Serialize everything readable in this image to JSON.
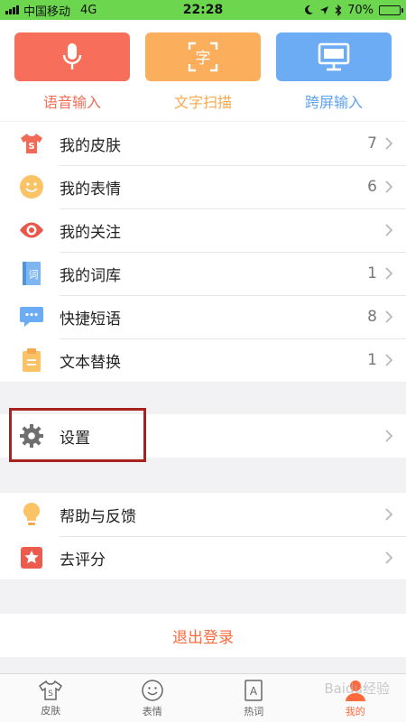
{
  "status_bar": {
    "carrier": "中国移动",
    "network": "4G",
    "time": "22:28",
    "battery_percent": "70%",
    "battery_level": 0.7,
    "icons": [
      "moon-icon",
      "location-icon",
      "bluetooth-icon"
    ]
  },
  "top_actions": [
    {
      "label": "语音输入",
      "icon": "microphone-icon",
      "tile_color": "#f76f5b",
      "label_color": "#f26e57"
    },
    {
      "label": "文字扫描",
      "icon": "scan-text-icon",
      "tile_color": "#fbae5c",
      "label_color": "#f6a94c",
      "glyph": "字"
    },
    {
      "label": "跨屏输入",
      "icon": "monitor-icon",
      "tile_color": "#6cacf5",
      "label_color": "#5ea2ef"
    }
  ],
  "list_main": [
    {
      "label": "我的皮肤",
      "count": "7",
      "icon": "tshirt-icon"
    },
    {
      "label": "我的表情",
      "count": "6",
      "icon": "smiley-icon"
    },
    {
      "label": "我的关注",
      "count": "",
      "icon": "eye-icon"
    },
    {
      "label": "我的词库",
      "count": "1",
      "icon": "dictionary-icon",
      "glyph": "词"
    },
    {
      "label": "快捷短语",
      "count": "8",
      "icon": "chat-bubble-icon"
    },
    {
      "label": "文本替换",
      "count": "1",
      "icon": "clipboard-icon"
    }
  ],
  "list_settings": [
    {
      "label": "设置",
      "count": "",
      "icon": "gear-icon"
    }
  ],
  "list_help": [
    {
      "label": "帮助与反馈",
      "count": "",
      "icon": "lightbulb-icon"
    },
    {
      "label": "去评分",
      "count": "",
      "icon": "star-icon"
    }
  ],
  "logout_label": "退出登录",
  "tabs": [
    {
      "label": "皮肤",
      "icon": "tshirt-tab-icon",
      "active": false
    },
    {
      "label": "表情",
      "icon": "smiley-tab-icon",
      "active": false
    },
    {
      "label": "热词",
      "icon": "hotword-tab-icon",
      "active": false,
      "glyph": "A"
    },
    {
      "label": "我的",
      "icon": "profile-tab-icon",
      "active": true
    }
  ],
  "colors": {
    "accent": "#ff6a3d",
    "status_bar": "#6bd64e",
    "highlight": "#a8231d"
  },
  "watermark": "Baidu经验"
}
